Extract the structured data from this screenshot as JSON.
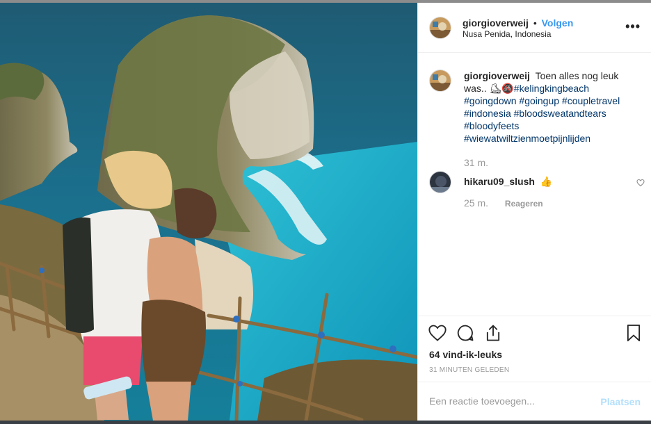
{
  "post": {
    "author": {
      "username": "giorgioverweij",
      "follow_label": "Volgen",
      "separator": "•",
      "location": "Nusa Penida, Indonesia"
    },
    "more_label": "•••",
    "caption": {
      "username": "giorgioverweij",
      "text": "Toen alles nog leuk was..",
      "emojis": "⛸🚳",
      "hashtags_line1": "#kelingkingbeach",
      "hashtags": [
        "#goingdown",
        "#goingup",
        "#coupletravel",
        "#indonesia",
        "#bloodsweatandtears",
        "#bloodyfeets",
        "#wiewatwiltzienmoetpijnlijden"
      ],
      "age": "31 m."
    },
    "comments": [
      {
        "username": "hikaru09_slush",
        "text": "👍",
        "age": "25 m.",
        "reply_label": "Reageren"
      }
    ],
    "likes": "64 vind-ik-leuks",
    "timestamp": "31 MINUTEN GELEDEN",
    "add_comment": {
      "placeholder": "Een reactie toevoegen...",
      "post_label": "Plaatsen"
    }
  },
  "icons": {
    "like": "heart-icon",
    "comment": "comment-icon",
    "share": "share-icon",
    "save": "bookmark-icon",
    "more": "more-options-icon",
    "comment_like": "heart-small-icon"
  },
  "colors": {
    "link": "#3897f0",
    "hashtag": "#003569",
    "muted": "#999999",
    "text": "#262626",
    "post_disabled": "#b2dffc",
    "border": "#efefef"
  }
}
